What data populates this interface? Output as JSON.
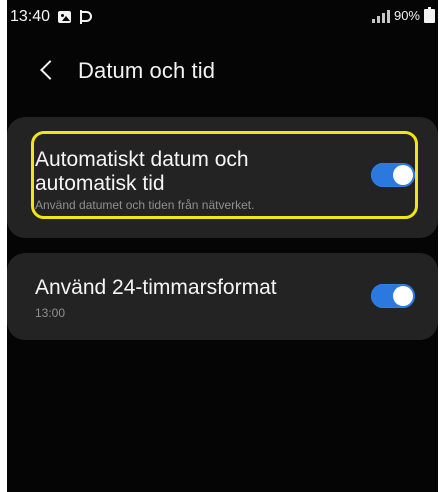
{
  "status_bar": {
    "time": "13:40",
    "battery": "90%",
    "icons": [
      "image-icon",
      "p-icon",
      "signal-icon",
      "battery-icon"
    ]
  },
  "header": {
    "title": "Datum och tid",
    "back_icon": "chevron-left-icon"
  },
  "settings": [
    {
      "title_line_1": "Automatiskt datum och",
      "title_line_2": "automatisk tid",
      "subtitle": "Använd datumet och tiden från nätverket.",
      "toggle_state": "on"
    },
    {
      "title": "Använd 24-timmarsformat",
      "subtitle": "13:00",
      "toggle_state": "on"
    }
  ],
  "colors": {
    "background": "#050505",
    "card": "#232323",
    "highlight": "#f2e517",
    "toggle": "#2b78de",
    "text_primary": "#f5f5f5",
    "text_secondary": "#8f8f8f"
  }
}
